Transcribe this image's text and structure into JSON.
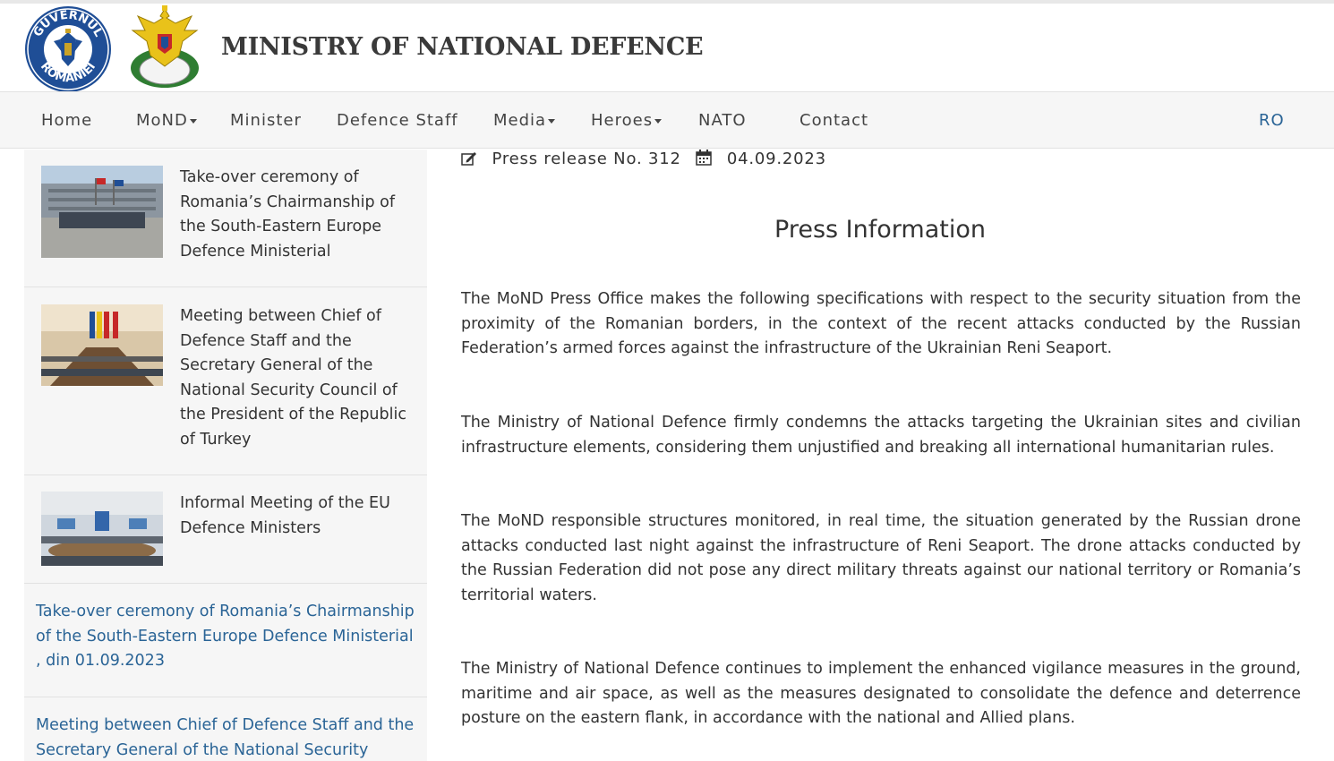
{
  "header": {
    "title": "MINISTRY OF NATIONAL DEFENCE",
    "gov_logo_text": "GUVERNUL ROMÂNIEI"
  },
  "nav": {
    "items": [
      {
        "label": "Home",
        "dropdown": false
      },
      {
        "label": "MoND",
        "dropdown": true
      },
      {
        "label": "Minister",
        "dropdown": false
      },
      {
        "label": "Defence Staff",
        "dropdown": false
      },
      {
        "label": "Media",
        "dropdown": true
      },
      {
        "label": "Heroes",
        "dropdown": true
      },
      {
        "label": "NATO",
        "dropdown": false
      },
      {
        "label": "Contact",
        "dropdown": false
      }
    ],
    "language": "RO"
  },
  "sidebar": {
    "news": [
      {
        "title": "Take-over ceremony of Romania’s Chairmanship of the South-Eastern Europe Defence Ministerial"
      },
      {
        "title": "Meeting between Chief of Defence Staff and the Secretary General of the National Security Council of the President of the Republic of Turkey"
      },
      {
        "title": "Informal Meeting of the EU Defence Ministers"
      }
    ],
    "links": [
      {
        "text": "Take-over ceremony of Romania’s Chairmanship of the South-Eastern Europe Defence Ministerial , din 01.09.2023"
      },
      {
        "text": "Meeting between Chief of Defence Staff and the Secretary General of the National Security Council"
      }
    ]
  },
  "article": {
    "release": "Press release No. 312",
    "date": "04.09.2023",
    "heading": "Press Information",
    "paragraphs": [
      "The MoND Press Office makes the following specifications with respect to the security situation from the proximity of the Romanian borders, in the context of the recent attacks conducted by the Russian Federation’s armed forces against the infrastructure of the Ukrainian Reni Seaport.",
      "The Ministry of National Defence firmly condemns the attacks targeting the Ukrainian sites and civilian infrastructure elements, considering them unjustified and breaking all international humanitarian rules.",
      "The MoND responsible structures monitored, in real time, the situation generated by the Russian drone attacks conducted last night against the infrastructure of Reni Seaport. The drone attacks conducted by the Russian Federation did not pose any direct military threats against our national territory or Romania’s territorial waters.",
      "The Ministry of National Defence continues to implement the enhanced vigilance measures in the ground, maritime and air space, as well as the measures designated to consolidate the defence and deterrence posture on the eastern flank, in accordance with the national and Allied plans."
    ]
  },
  "colors": {
    "link": "#2a6496",
    "nav_bg": "#f6f6f6",
    "gov_blue": "#1f4e96"
  }
}
